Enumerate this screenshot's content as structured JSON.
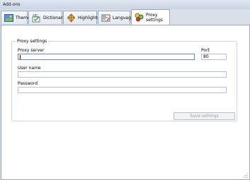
{
  "window": {
    "title": "Add-ons"
  },
  "tabs": [
    {
      "label": "Themes",
      "icon": "themes-icon",
      "active": false
    },
    {
      "label": "Dictionaries",
      "icon": "dictionary-icon",
      "active": false
    },
    {
      "label": "Highlighters",
      "icon": "highlighter-icon",
      "active": false
    },
    {
      "label": "Languages",
      "icon": "languages-icon",
      "active": false
    },
    {
      "label": "Proxy settings",
      "icon": "proxy-icon",
      "active": true
    }
  ],
  "proxy": {
    "group_label": "Proxy settings",
    "server_label": "Proxy server",
    "server_value": "",
    "port_label": "Port",
    "port_value": "80",
    "username_label": "User name",
    "username_value": "",
    "password_label": "Password",
    "password_value": "",
    "save_label": "Save settings"
  },
  "colors": {
    "accent": "#6b8ab3",
    "tab_border": "#9aa8bb",
    "disabled_text": "#9ba3ad"
  }
}
